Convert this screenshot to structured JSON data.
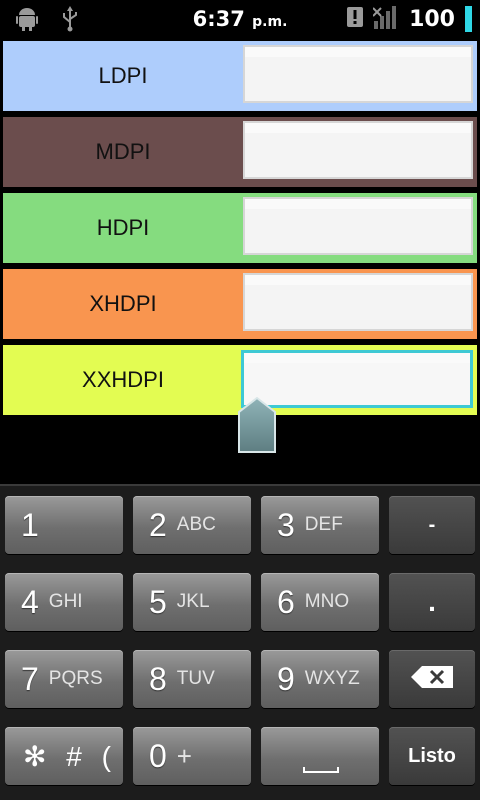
{
  "status_bar": {
    "time": "6:37",
    "ampm": "p.m.",
    "battery": "100",
    "icons": [
      "android-icon",
      "usb-icon",
      "alert-icon",
      "signal-icon"
    ],
    "accent": "#2fd7e6"
  },
  "rows": [
    {
      "label": "LDPI",
      "color": "#aecdfc",
      "value": ""
    },
    {
      "label": "MDPI",
      "color": "#6b4d4d",
      "value": ""
    },
    {
      "label": "HDPI",
      "color": "#85dc7f",
      "value": ""
    },
    {
      "label": "XHDPI",
      "color": "#f9954f",
      "value": ""
    },
    {
      "label": "XXHDPI",
      "color": "#e3fc52",
      "value": ""
    }
  ],
  "keyboard": {
    "keys": [
      {
        "num": "1",
        "letters": ""
      },
      {
        "num": "2",
        "letters": "ABC"
      },
      {
        "num": "3",
        "letters": "DEF"
      },
      {
        "num": "4",
        "letters": "GHI"
      },
      {
        "num": "5",
        "letters": "JKL"
      },
      {
        "num": "6",
        "letters": "MNO"
      },
      {
        "num": "7",
        "letters": "PQRS"
      },
      {
        "num": "8",
        "letters": "TUV"
      },
      {
        "num": "9",
        "letters": "WXYZ"
      },
      {
        "num": "✻ # (",
        "letters": ""
      },
      {
        "num": "0",
        "letters": "+"
      }
    ],
    "minus": "-",
    "dot": ".",
    "delete_icon": "backspace-icon",
    "done": "Listo"
  }
}
